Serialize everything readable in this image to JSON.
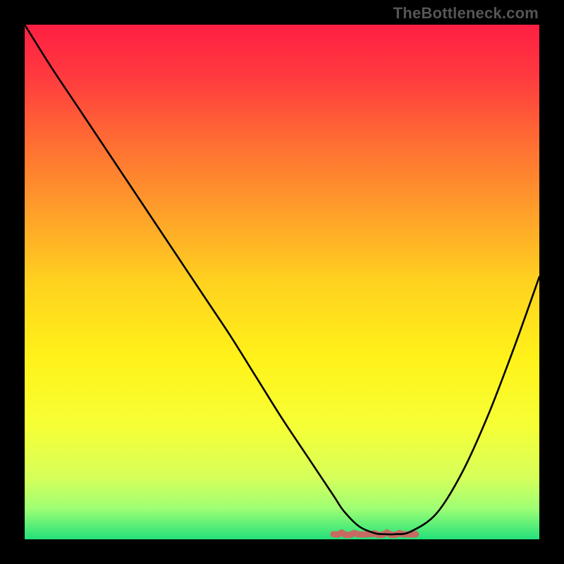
{
  "watermark": "TheBottleneck.com",
  "chart_data": {
    "type": "line",
    "title": "",
    "xlabel": "",
    "ylabel": "",
    "xlim": [
      0,
      100
    ],
    "ylim": [
      0,
      100
    ],
    "x": [
      0,
      5,
      10,
      15,
      20,
      25,
      30,
      35,
      40,
      45,
      50,
      55,
      60,
      62,
      65,
      68,
      70,
      72,
      75,
      80,
      85,
      90,
      95,
      100
    ],
    "values": [
      100,
      92,
      84.5,
      77,
      69.5,
      62,
      54.5,
      47,
      39.5,
      31.5,
      23.5,
      16,
      8.5,
      5.5,
      2.5,
      1.2,
      1.0,
      1.0,
      1.5,
      5,
      13,
      24,
      37,
      51
    ],
    "curve_color": "#000000",
    "curve_width": 2.6,
    "flat_marker": {
      "x_start": 60,
      "x_end": 76,
      "y": 1.0,
      "color": "#c66a62",
      "width": 9
    },
    "background_gradient": {
      "stops": [
        {
          "offset": 0.0,
          "color": "#ff1f43"
        },
        {
          "offset": 0.1,
          "color": "#ff3a3f"
        },
        {
          "offset": 0.22,
          "color": "#ff6a34"
        },
        {
          "offset": 0.35,
          "color": "#ff9a2b"
        },
        {
          "offset": 0.5,
          "color": "#ffd21f"
        },
        {
          "offset": 0.65,
          "color": "#fff219"
        },
        {
          "offset": 0.78,
          "color": "#f6ff36"
        },
        {
          "offset": 0.88,
          "color": "#d6ff5a"
        },
        {
          "offset": 0.94,
          "color": "#9fff74"
        },
        {
          "offset": 1.0,
          "color": "#22e07a"
        }
      ]
    }
  }
}
